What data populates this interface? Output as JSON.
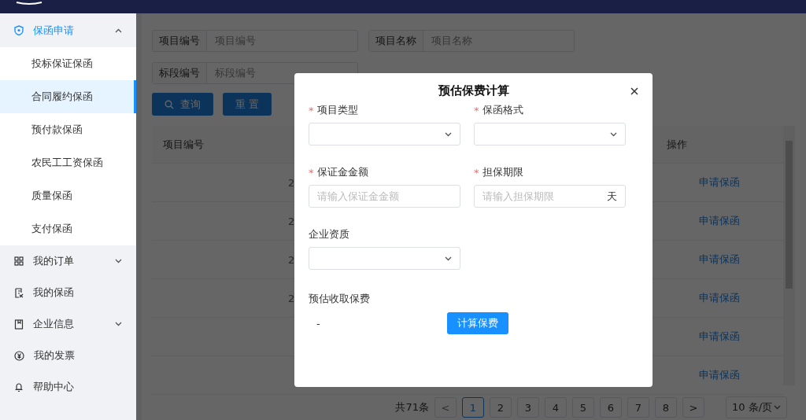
{
  "sidebar": {
    "items": [
      {
        "label": "保函申请",
        "selected": true,
        "expanded": true,
        "children": [
          {
            "label": "投标保证保函",
            "selected": false
          },
          {
            "label": "合同履约保函",
            "selected": true
          },
          {
            "label": "预付款保函",
            "selected": false
          },
          {
            "label": "农民工工资保函",
            "selected": false
          },
          {
            "label": "质量保函",
            "selected": false
          },
          {
            "label": "支付保函",
            "selected": false
          }
        ]
      },
      {
        "label": "我的订单",
        "selected": false,
        "expanded": false
      },
      {
        "label": "我的保函",
        "selected": false
      },
      {
        "label": "企业信息",
        "selected": false,
        "expanded": false
      },
      {
        "label": "我的发票",
        "selected": false
      },
      {
        "label": "帮助中心",
        "selected": false
      }
    ]
  },
  "search_form": {
    "fields": [
      {
        "label": "项目编号",
        "placeholder": "项目编号"
      },
      {
        "label": "项目名称",
        "placeholder": "项目名称"
      },
      {
        "label": "标段编号",
        "placeholder": "标段编号"
      }
    ],
    "buttons": [
      {
        "label": "查询",
        "kind": "search"
      },
      {
        "label": "重 置",
        "kind": "plain"
      }
    ]
  },
  "table": {
    "columns": [
      "项目编号",
      "操作"
    ],
    "rows": [
      {
        "column_2": "2",
        "action": "申请保函"
      },
      {
        "column_2": "2",
        "action": "申请保函"
      },
      {
        "column_2": "2",
        "action": "申请保函"
      },
      {
        "column_2": "2",
        "action": "申请保函"
      },
      {
        "action": "申请保函"
      },
      {
        "action": "申请保函"
      }
    ]
  },
  "pagination": {
    "total": "共71条",
    "prev": "<",
    "next": ">",
    "pages": [
      {
        "label": "1",
        "selected": true
      },
      {
        "label": "2",
        "selected": false
      },
      {
        "label": "3",
        "selected": false
      },
      {
        "label": "4",
        "selected": false
      },
      {
        "label": "5",
        "selected": false
      },
      {
        "label": "6",
        "selected": false
      },
      {
        "label": "7",
        "selected": false
      },
      {
        "label": "8",
        "selected": false
      }
    ],
    "page_size": "10 条/页"
  },
  "dialog": {
    "title": "预估保费计算",
    "fields": [
      {
        "label": "项目类型",
        "marker": "*",
        "kind": "select"
      },
      {
        "label": "保函格式",
        "marker": "*",
        "kind": "select"
      },
      {
        "label": "保证金金额",
        "marker": "*",
        "kind": "input",
        "placeholder": "请输入保证金金额"
      },
      {
        "label": "担保期限",
        "marker": "*",
        "kind": "input",
        "placeholder": "请输入担保期限",
        "suffix": "天"
      },
      {
        "label": "企业资质",
        "kind": "select"
      }
    ],
    "result_label": "预估收取保费",
    "result_value": "-",
    "button": "计算保费"
  }
}
